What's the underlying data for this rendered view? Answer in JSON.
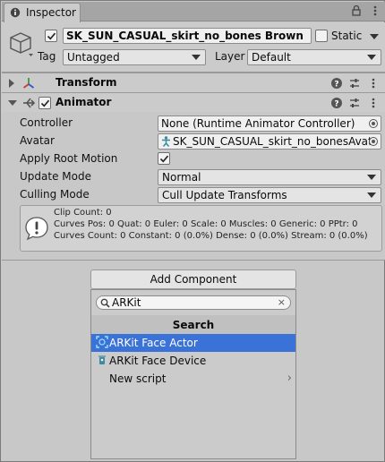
{
  "tab": {
    "title": "Inspector"
  },
  "gameobject": {
    "name": "SK_SUN_CASUAL_skirt_no_bones Brown",
    "static_label": "Static",
    "tag_label": "Tag",
    "tag_value": "Untagged",
    "layer_label": "Layer",
    "layer_value": "Default"
  },
  "components": {
    "transform": {
      "title": "Transform"
    },
    "animator": {
      "title": "Animator",
      "controller_label": "Controller",
      "controller_value": "None (Runtime Animator Controller)",
      "avatar_label": "Avatar",
      "avatar_value": "SK_SUN_CASUAL_skirt_no_bonesAvat",
      "apply_root_motion_label": "Apply Root Motion",
      "update_mode_label": "Update Mode",
      "update_mode_value": "Normal",
      "culling_mode_label": "Culling Mode",
      "culling_mode_value": "Cull Update Transforms",
      "info": {
        "line1": "Clip Count: 0",
        "line2": "Curves Pos: 0 Quat: 0 Euler: 0 Scale: 0 Muscles: 0 Generic: 0 PPtr: 0",
        "line3": "Curves Count: 0 Constant: 0 (0.0%) Dense: 0 (0.0%) Stream: 0 (0.0%)"
      }
    }
  },
  "add_component": {
    "button_label": "Add Component",
    "search_value": "ARKit",
    "clear_glyph": "×",
    "list_title": "Search",
    "items": [
      {
        "label": "ARKit Face Actor",
        "icon": "face-actor-icon"
      },
      {
        "label": "ARKit Face Device",
        "icon": "face-device-icon"
      },
      {
        "label": "New script",
        "icon": ""
      }
    ]
  },
  "colors": {
    "selection": "#3a72d7"
  }
}
